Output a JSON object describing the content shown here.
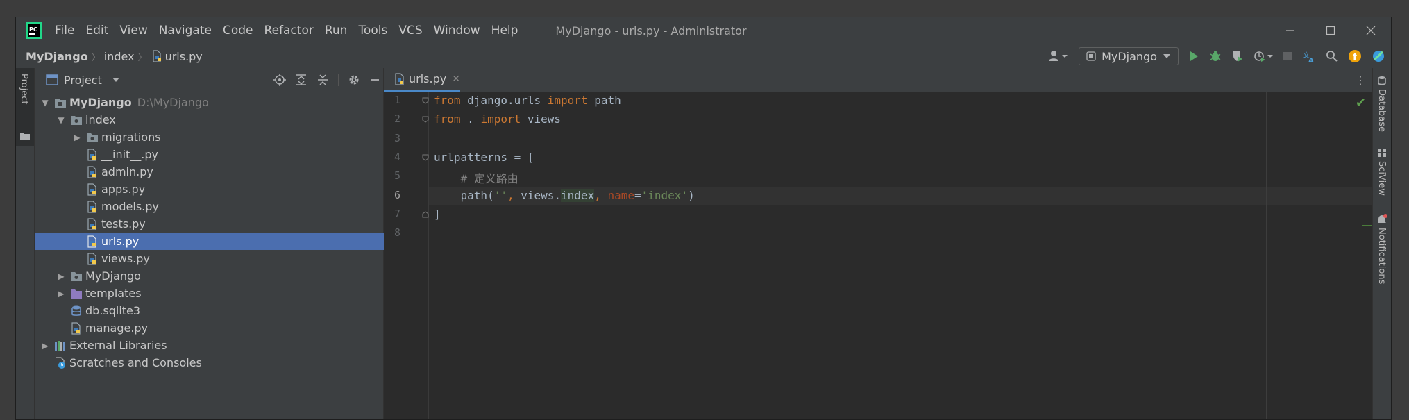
{
  "window": {
    "title": "MyDjango - urls.py - Administrator"
  },
  "menu": [
    "File",
    "Edit",
    "View",
    "Navigate",
    "Code",
    "Refactor",
    "Run",
    "Tools",
    "VCS",
    "Window",
    "Help"
  ],
  "breadcrumb": [
    "MyDjango",
    "index",
    "urls.py"
  ],
  "toolbar": {
    "run_config": "MyDjango"
  },
  "left_stripe": {
    "project_tab": "Project"
  },
  "right_stripe": [
    "Database",
    "SciView",
    "Notifications"
  ],
  "project_panel": {
    "title": "Project",
    "tree": [
      {
        "label": "MyDjango",
        "hint": "D:\\MyDjango",
        "depth": 0,
        "type": "module",
        "arrow": "down"
      },
      {
        "label": "index",
        "depth": 1,
        "type": "folder",
        "arrow": "down"
      },
      {
        "label": "migrations",
        "depth": 2,
        "type": "folder",
        "arrow": "right"
      },
      {
        "label": "__init__.py",
        "depth": 2,
        "type": "py",
        "arrow": ""
      },
      {
        "label": "admin.py",
        "depth": 2,
        "type": "py",
        "arrow": ""
      },
      {
        "label": "apps.py",
        "depth": 2,
        "type": "py",
        "arrow": ""
      },
      {
        "label": "models.py",
        "depth": 2,
        "type": "py",
        "arrow": ""
      },
      {
        "label": "tests.py",
        "depth": 2,
        "type": "py",
        "arrow": ""
      },
      {
        "label": "urls.py",
        "depth": 2,
        "type": "py",
        "arrow": "",
        "selected": true
      },
      {
        "label": "views.py",
        "depth": 2,
        "type": "py",
        "arrow": ""
      },
      {
        "label": "MyDjango",
        "depth": 1,
        "type": "folder",
        "arrow": "right"
      },
      {
        "label": "templates",
        "depth": 1,
        "type": "folder-purple",
        "arrow": "right"
      },
      {
        "label": "db.sqlite3",
        "depth": 1,
        "type": "db",
        "arrow": ""
      },
      {
        "label": "manage.py",
        "depth": 1,
        "type": "py",
        "arrow": ""
      },
      {
        "label": "External Libraries",
        "depth": 0,
        "type": "lib",
        "arrow": "right"
      },
      {
        "label": "Scratches and Consoles",
        "depth": 0,
        "type": "scratch",
        "arrow": ""
      }
    ]
  },
  "editor": {
    "tab": "urls.py",
    "current_line": 6,
    "line_numbers": [
      "1",
      "2",
      "3",
      "4",
      "5",
      "6",
      "7",
      "8"
    ],
    "lines": {
      "l1": {
        "a": "from",
        "b": " django.urls ",
        "c": "import",
        "d": " path"
      },
      "l2": {
        "a": "from",
        "b": " . ",
        "c": "import",
        "d": " views"
      },
      "l4": "urlpatterns = [",
      "l5": "    # 定义路由",
      "l6": {
        "a": "    path(",
        "b": "''",
        "c": ", ",
        "d": "views.",
        "e": "index",
        "f": ", ",
        "g": "name",
        "h": "=",
        "i": "'index'",
        "j": ")"
      },
      "l7": "]"
    }
  },
  "colors": {
    "selection": "#4b6eaf",
    "keyword": "#cc7832",
    "string": "#6a8759",
    "comment": "#808080",
    "param": "#aa4926",
    "run_green": "#59a869",
    "update_orange": "#f0a30a"
  }
}
